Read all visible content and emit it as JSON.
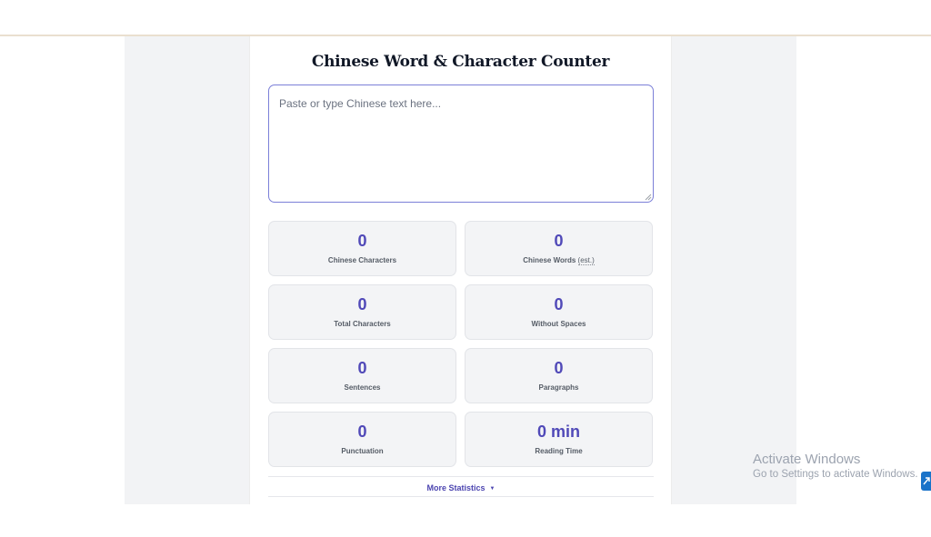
{
  "app": {
    "title": "Chinese Word & Character Counter"
  },
  "input": {
    "placeholder": "Paste or type Chinese text here...",
    "value": ""
  },
  "stats": [
    {
      "id": "chinese-characters",
      "value": "0",
      "label": "Chinese Characters"
    },
    {
      "id": "chinese-words",
      "value": "0",
      "label": "Chinese Words",
      "note": "(est.)"
    },
    {
      "id": "total-characters",
      "value": "0",
      "label": "Total Characters"
    },
    {
      "id": "without-spaces",
      "value": "0",
      "label": "Without Spaces"
    },
    {
      "id": "sentences",
      "value": "0",
      "label": "Sentences"
    },
    {
      "id": "paragraphs",
      "value": "0",
      "label": "Paragraphs"
    },
    {
      "id": "punctuation",
      "value": "0",
      "label": "Punctuation"
    },
    {
      "id": "reading-time",
      "value": "0 min",
      "label": "Reading Time"
    }
  ],
  "more_statistics": {
    "label": "More Statistics",
    "arrow": "▼"
  },
  "watermark": {
    "title": "Activate Windows",
    "subtitle": "Go to Settings to activate Windows."
  },
  "colors": {
    "accent": "#5049b8",
    "card_bg": "#f3f4f6",
    "focus_border": "#7b7fd8",
    "title_text": "#111827"
  },
  "icons": {
    "resize_grip": "resize-grip-icon",
    "dropdown": "triangle-down-icon",
    "corner_button": "arrow-expand-icon"
  }
}
